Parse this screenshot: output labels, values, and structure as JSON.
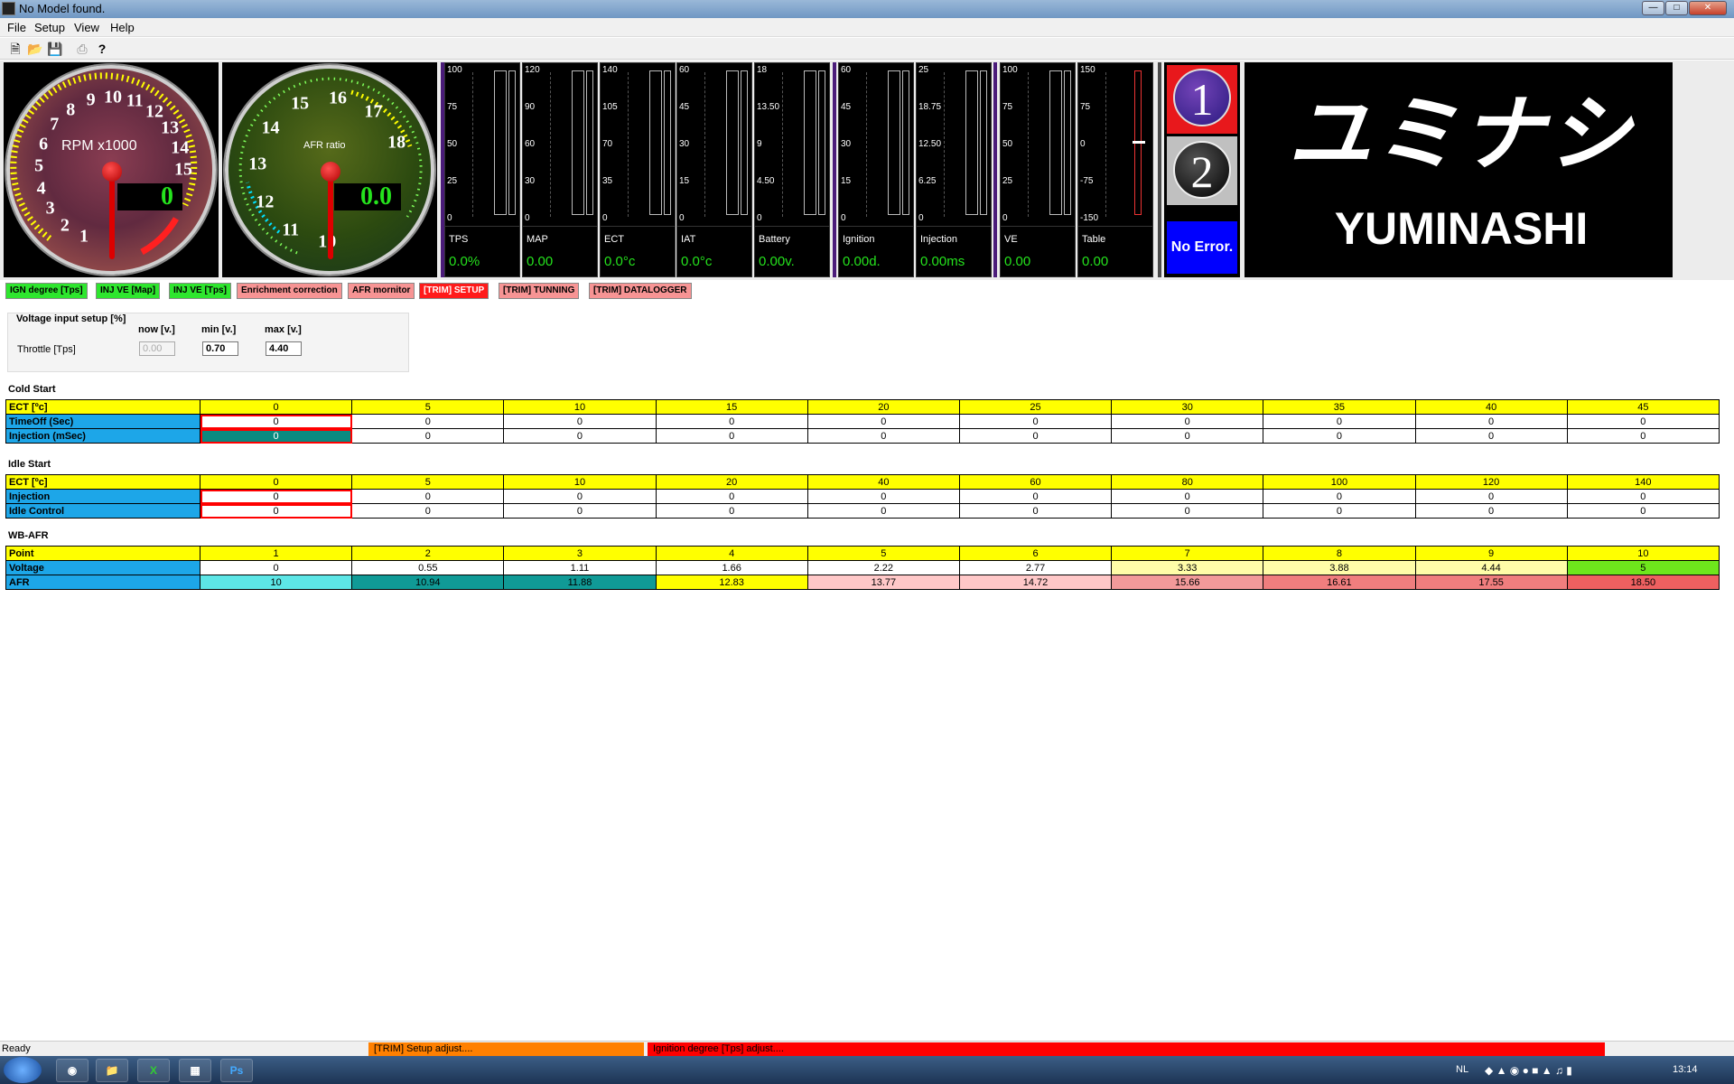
{
  "window": {
    "title": "No Model found."
  },
  "menu": [
    "File",
    "Setup",
    "View",
    "Help"
  ],
  "toolbar_icons": [
    "new-file-icon",
    "open-folder-icon",
    "save-icon",
    "print-icon",
    "help-icon"
  ],
  "rpm_gauge": {
    "label": "RPM x1000",
    "readout": "0",
    "numbers": [
      "1",
      "2",
      "3",
      "4",
      "5",
      "6",
      "7",
      "8",
      "9",
      "10",
      "11",
      "12",
      "13",
      "14",
      "15"
    ]
  },
  "afr_gauge": {
    "label": "AFR ratio",
    "readout": "0.0",
    "numbers": [
      "10",
      "11",
      "12",
      "13",
      "14",
      "15",
      "16",
      "17",
      "18"
    ]
  },
  "bars": [
    {
      "label": "TPS",
      "value": "0.0%",
      "ticks": [
        "100",
        "75",
        "50",
        "25",
        "0"
      ]
    },
    {
      "label": "MAP",
      "value": "0.00",
      "ticks": [
        "120",
        "90",
        "60",
        "30",
        "0"
      ]
    },
    {
      "label": "ECT",
      "value": "0.0°c",
      "ticks": [
        "140",
        "105",
        "70",
        "35",
        "0"
      ]
    },
    {
      "label": "IAT",
      "value": "0.0°c",
      "ticks": [
        "60",
        "45",
        "30",
        "15",
        "0"
      ]
    },
    {
      "label": "Battery",
      "value": "0.00v.",
      "ticks": [
        "18",
        "13.50",
        "9",
        "4.50",
        "0"
      ]
    },
    {
      "label": "Ignition",
      "value": "0.00d.",
      "ticks": [
        "60",
        "45",
        "30",
        "15",
        "0"
      ]
    },
    {
      "label": "Injection",
      "value": "0.00ms",
      "ticks": [
        "25",
        "18.75",
        "12.50",
        "6.25",
        "0"
      ]
    },
    {
      "label": "VE",
      "value": "0.00",
      "ticks": [
        "100",
        "75",
        "50",
        "25",
        "0"
      ]
    },
    {
      "label": "Table",
      "value": "0.00",
      "ticks": [
        "150",
        "75",
        "0",
        "-75",
        "-150"
      ]
    }
  ],
  "indicators": {
    "one": "1",
    "two": "2",
    "error": "No Error."
  },
  "logo": {
    "jp": "ユミナシ",
    "en": "YUMINASHI"
  },
  "tabs": [
    {
      "label": "IGN degree [Tps]",
      "style": "g"
    },
    {
      "label": "INJ VE [Map]",
      "style": "g"
    },
    {
      "label": "INJ VE [Tps]",
      "style": "g"
    },
    {
      "label": "Enrichment correction",
      "style": "p"
    },
    {
      "label": "AFR mornitor",
      "style": "p"
    },
    {
      "label": "[TRIM] SETUP",
      "style": "r"
    },
    {
      "label": "[TRIM] TUNNING",
      "style": "pr"
    },
    {
      "label": "[TRIM] DATALOGGER",
      "style": "pr"
    }
  ],
  "voltage_setup": {
    "title": "Voltage input setup [%]",
    "col_now": "now [v.]",
    "col_min": "min [v.]",
    "col_max": "max [v.]",
    "row_label": "Throttle [Tps]",
    "now": "0.00",
    "min": "0.70",
    "max": "4.40"
  },
  "cold_start": {
    "title": "Cold Start",
    "rows": [
      {
        "label": "ECT [ºc]",
        "values": [
          "0",
          "5",
          "10",
          "15",
          "20",
          "25",
          "30",
          "35",
          "40",
          "45"
        ]
      },
      {
        "label": "TimeOff (Sec)",
        "values": [
          "0",
          "0",
          "0",
          "0",
          "0",
          "0",
          "0",
          "0",
          "0",
          "0"
        ]
      },
      {
        "label": "Injection (mSec)",
        "values": [
          "0",
          "0",
          "0",
          "0",
          "0",
          "0",
          "0",
          "0",
          "0",
          "0"
        ]
      }
    ]
  },
  "idle_start": {
    "title": "Idle Start",
    "rows": [
      {
        "label": "ECT [ºc]",
        "values": [
          "0",
          "5",
          "10",
          "20",
          "40",
          "60",
          "80",
          "100",
          "120",
          "140"
        ]
      },
      {
        "label": "Injection",
        "values": [
          "0",
          "0",
          "0",
          "0",
          "0",
          "0",
          "0",
          "0",
          "0",
          "0"
        ]
      },
      {
        "label": "Idle Control",
        "values": [
          "0",
          "0",
          "0",
          "0",
          "0",
          "0",
          "0",
          "0",
          "0",
          "0"
        ]
      }
    ]
  },
  "wb_afr": {
    "title": "WB-AFR",
    "rows": [
      {
        "label": "Point",
        "values": [
          "1",
          "2",
          "3",
          "4",
          "5",
          "6",
          "7",
          "8",
          "9",
          "10"
        ]
      },
      {
        "label": "Voltage",
        "values": [
          "0",
          "0.55",
          "1.11",
          "1.66",
          "2.22",
          "2.77",
          "3.33",
          "3.88",
          "4.44",
          "5"
        ]
      },
      {
        "label": "AFR",
        "values": [
          "10",
          "10.94",
          "11.88",
          "12.83",
          "13.77",
          "14.72",
          "15.66",
          "16.61",
          "17.55",
          "18.50"
        ]
      }
    ],
    "voltage_colors": [
      "#ffffff",
      "#ffffff",
      "#ffffff",
      "#ffffff",
      "#ffffff",
      "#ffffff",
      "#fffda8",
      "#fffda8",
      "#fffda8",
      "#6ee61c"
    ],
    "afr_colors": [
      "#5de6e6",
      "#109a96",
      "#109a96",
      "#ffff00",
      "#ffc8c8",
      "#ffc8c8",
      "#f29a9a",
      "#f07e7e",
      "#f07e7e",
      "#ee6060"
    ]
  },
  "status": {
    "left": "Ready",
    "mid": "[TRIM] Setup adjust....",
    "right": "Ignition degree [Tps] adjust...."
  },
  "taskbar": {
    "lang": "NL",
    "time": "13:14"
  }
}
